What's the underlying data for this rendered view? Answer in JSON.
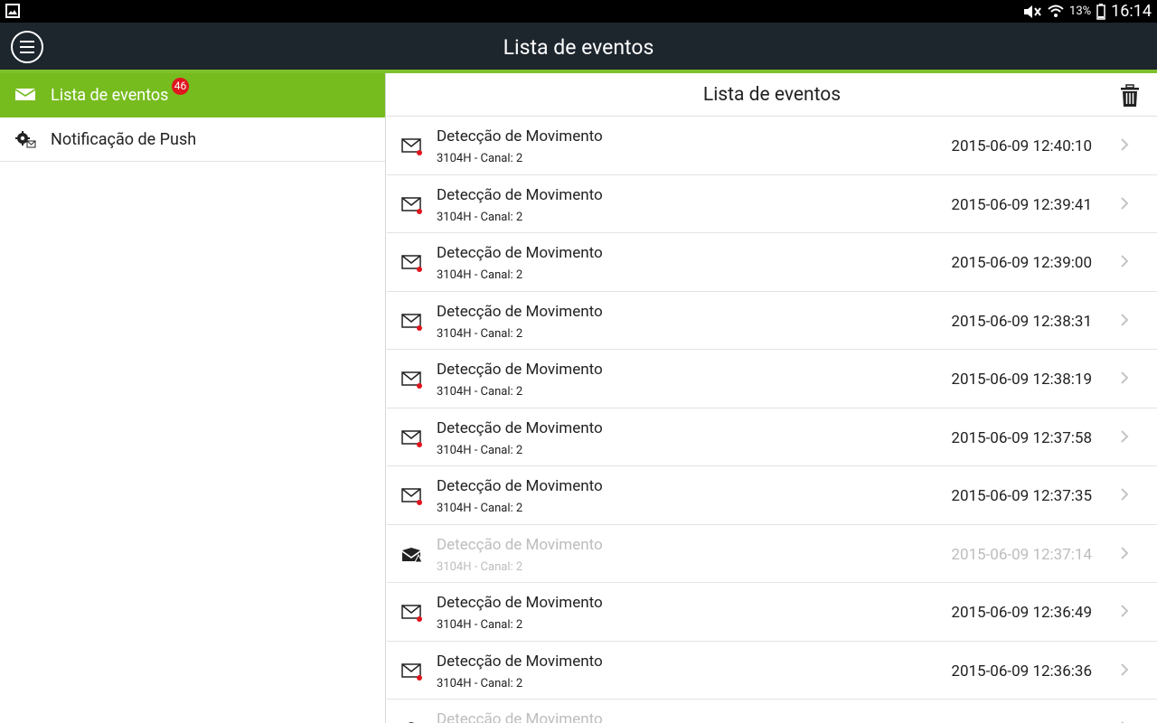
{
  "status_bar": {
    "battery": "13%",
    "time": "16:14"
  },
  "app_bar": {
    "title": "Lista de eventos",
    "menu_icon": "hamburger-menu-icon"
  },
  "sidebar": {
    "items": [
      {
        "label": "Lista de eventos",
        "icon": "envelope-icon",
        "badge": "46",
        "active": true
      },
      {
        "label": "Notificação de Push",
        "icon": "gear-mail-icon",
        "active": false
      }
    ]
  },
  "main": {
    "header_title": "Lista de eventos",
    "trash_icon": "trash-icon",
    "events": [
      {
        "title": "Detecção de Movimento",
        "subtitle": "3104H - Canal: 2",
        "time": "2015-06-09 12:40:10",
        "read": false
      },
      {
        "title": "Detecção de Movimento",
        "subtitle": "3104H - Canal: 2",
        "time": "2015-06-09 12:39:41",
        "read": false
      },
      {
        "title": "Detecção de Movimento",
        "subtitle": "3104H - Canal: 2",
        "time": "2015-06-09 12:39:00",
        "read": false
      },
      {
        "title": "Detecção de Movimento",
        "subtitle": "3104H - Canal: 2",
        "time": "2015-06-09 12:38:31",
        "read": false
      },
      {
        "title": "Detecção de Movimento",
        "subtitle": "3104H - Canal: 2",
        "time": "2015-06-09 12:38:19",
        "read": false
      },
      {
        "title": "Detecção de Movimento",
        "subtitle": "3104H - Canal: 2",
        "time": "2015-06-09 12:37:58",
        "read": false
      },
      {
        "title": "Detecção de Movimento",
        "subtitle": "3104H - Canal: 2",
        "time": "2015-06-09 12:37:35",
        "read": false
      },
      {
        "title": "Detecção de Movimento",
        "subtitle": "3104H - Canal: 2",
        "time": "2015-06-09 12:37:14",
        "read": true
      },
      {
        "title": "Detecção de Movimento",
        "subtitle": "3104H - Canal: 2",
        "time": "2015-06-09 12:36:49",
        "read": false
      },
      {
        "title": "Detecção de Movimento",
        "subtitle": "3104H - Canal: 2",
        "time": "2015-06-09 12:36:36",
        "read": false
      },
      {
        "title": "Detecção de Movimento",
        "subtitle": "",
        "time": "",
        "read": true
      }
    ]
  },
  "colors": {
    "accent": "#77bc1f",
    "appbar": "#1d252d",
    "badge": "#e0161f",
    "unread_dot": "#e0161f"
  }
}
